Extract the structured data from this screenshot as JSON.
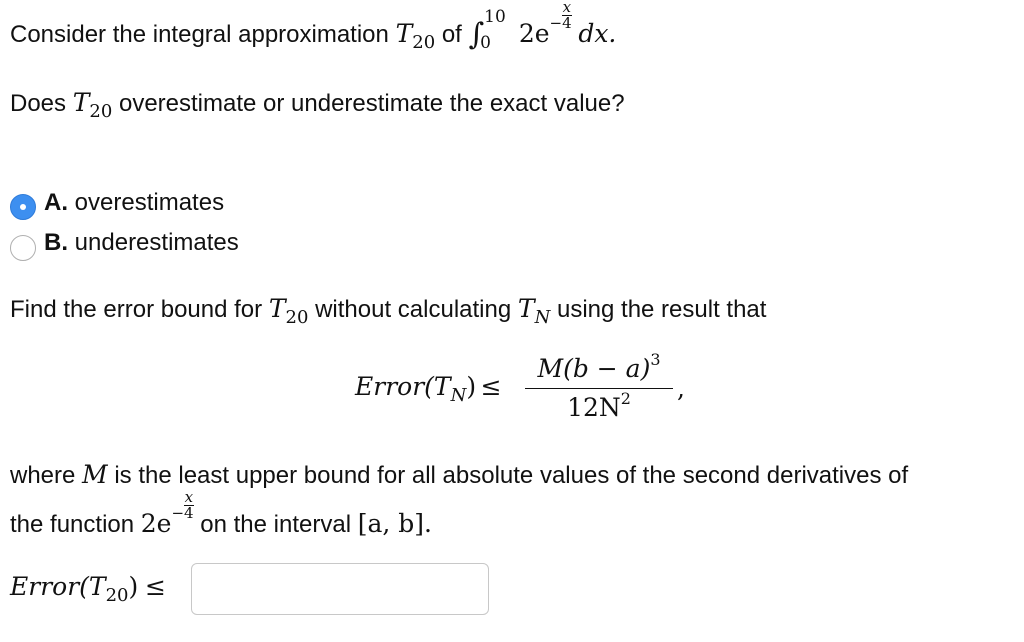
{
  "line1": {
    "text_before": "Consider the integral approximation",
    "T": "T",
    "n": "20",
    "text_of": "of",
    "upper": "10",
    "lower": "0",
    "coef": "2e",
    "exp_num": "x",
    "exp_den": "4",
    "dx": "dx."
  },
  "line2": {
    "text_before": "Does",
    "T": "T",
    "n": "20",
    "text_after": "overestimate or underestimate the exact value?"
  },
  "options": [
    {
      "letter": "A.",
      "text": "overestimates",
      "selected": true
    },
    {
      "letter": "B.",
      "text": "underestimates",
      "selected": false
    }
  ],
  "line3": {
    "text_before": "Find the error bound for",
    "T": "T",
    "n": "20",
    "text_middle": "without calculating",
    "TN": "T",
    "N": "N",
    "text_after": "using the result that"
  },
  "formula": {
    "lhs": "Error(T",
    "lhs_sub": "N",
    "lhs_close": ")",
    "leq": "≤",
    "num": "M(b − a)",
    "num_exp": "3",
    "den": "12N",
    "den_exp": "2",
    "comma": ","
  },
  "line4": {
    "text_before": "where",
    "M": "M",
    "text_after": "is the least upper bound for all absolute values of the second derivatives of"
  },
  "line5": {
    "text_before": "the function",
    "coef": "2e",
    "exp_num": "x",
    "exp_den": "4",
    "text_middle": "on the interval",
    "interval": "[a, b]."
  },
  "answer": {
    "label": "Error(T",
    "sub": "20",
    "label_close": ")",
    "leq": "≤",
    "value": ""
  },
  "colors": {
    "radio_selected": "#3d8ff0",
    "radio_border": "#b0b0b0"
  }
}
